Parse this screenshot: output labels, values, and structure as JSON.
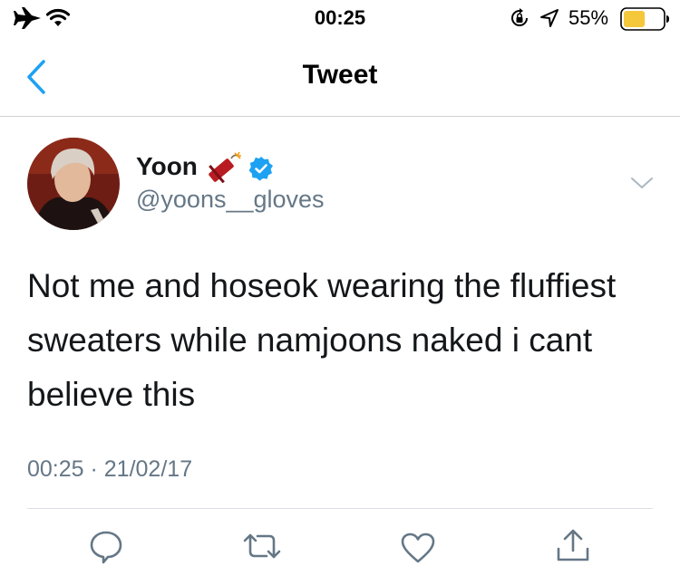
{
  "status_bar": {
    "time": "00:25",
    "battery_percent": "55%",
    "icons": [
      "airplane-icon",
      "wifi-icon",
      "orientation-lock-icon",
      "location-icon",
      "battery-icon"
    ]
  },
  "nav": {
    "title": "Tweet",
    "back_icon": "chevron-left-icon"
  },
  "tweet": {
    "display_name": "Yoon",
    "name_emoji": "firecracker-emoji",
    "verified": true,
    "handle": "@yoons__gloves",
    "text": "Not me and hoseok wearing the fluffiest sweaters while namjoons naked i cant believe this",
    "timestamp": "00:25 · 21/02/17"
  },
  "actions": [
    "reply-icon",
    "retweet-icon",
    "like-icon",
    "share-icon"
  ],
  "colors": {
    "accent": "#1da1f2",
    "secondary_text": "#657786",
    "battery_fill": "#f5c73b"
  }
}
